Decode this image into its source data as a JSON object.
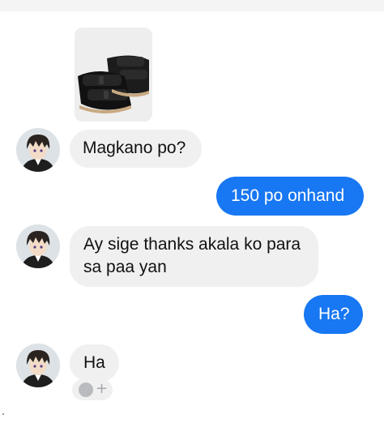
{
  "conversation": {
    "attachment": {
      "type": "image",
      "subject": "black two-strap sandals"
    },
    "messages": [
      {
        "sender": "them",
        "text": "Magkano po?"
      },
      {
        "sender": "me",
        "text": "150 po onhand"
      },
      {
        "sender": "them",
        "lines": [
          "Ay sige thanks akala ko para",
          "sa paa yan"
        ]
      },
      {
        "sender": "me",
        "text": "Ha?"
      },
      {
        "sender": "them",
        "text": "Ha"
      }
    ],
    "reaction_button": {
      "icon": "smiley-icon",
      "plus_symbol": "+"
    }
  },
  "colors": {
    "outgoing_bubble": "#1877f2",
    "incoming_bubble": "#f1f0f0",
    "outgoing_text": "#ffffff",
    "incoming_text": "#111111"
  }
}
